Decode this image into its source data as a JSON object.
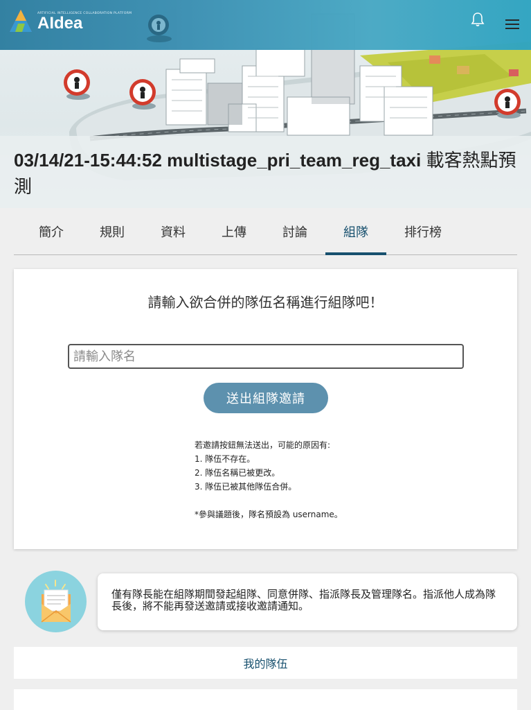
{
  "header": {
    "logo_small_text": "ARTIFICIAL INTELLIGENCE COLLABORATION PLATFORM",
    "logo_name": "AIdea",
    "icons": {
      "notification": "bell-icon",
      "menu": "hamburger-menu-icon"
    }
  },
  "competition": {
    "title_latin": "03/14/21-15:44:52 multistage_pri_team_reg_taxi",
    "title_cjk": " 載客熱點預測"
  },
  "tabs": [
    {
      "label": "簡介"
    },
    {
      "label": "規則"
    },
    {
      "label": "資料"
    },
    {
      "label": "上傳"
    },
    {
      "label": "討論"
    },
    {
      "label": "組隊",
      "active": true
    },
    {
      "label": "排行榜"
    }
  ],
  "merge_form": {
    "heading": "請輸入欲合併的隊伍名稱進行組隊吧！",
    "input_placeholder": "請輸入隊名",
    "input_value": "",
    "submit_label": "送出組隊邀請",
    "reasons_intro": "若邀請按鈕無法送出，可能的原因有:",
    "reasons": [
      "1. 隊伍不存在。",
      "2. 隊伍名稱已被更改。",
      "3. 隊伍已被其他隊伍合併。"
    ],
    "footnote": "*參與議題後，隊名預設為 username。"
  },
  "notice": {
    "icon": "envelope-icon",
    "text": "僅有隊長能在組隊期間發起組隊、同意併隊、指派隊長及管理隊名。指派他人成為隊長後，將不能再發送邀請或接收邀請通知。"
  },
  "my_team": {
    "label": "我的隊伍"
  },
  "colors": {
    "header": "#3b8fb2",
    "accent": "#17506e",
    "button": "#5d91ae",
    "notice_icon_bg": "#8bd3df"
  }
}
